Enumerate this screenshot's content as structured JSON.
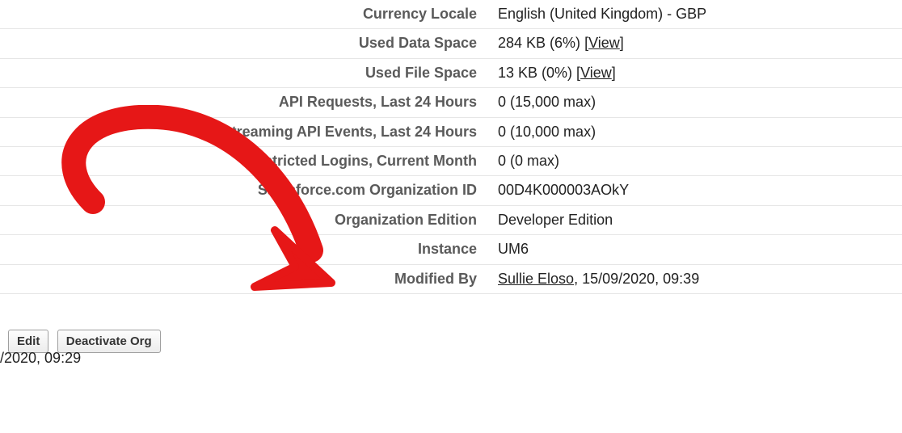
{
  "rows": {
    "currency_locale": {
      "label": "Currency Locale",
      "value": "English (United Kingdom) - GBP"
    },
    "used_data_space": {
      "label": "Used Data Space",
      "value": "284 KB (6%) ",
      "link_text": "View"
    },
    "used_file_space": {
      "label": "Used File Space",
      "value": "13 KB (0%) ",
      "link_text": "View"
    },
    "api_requests": {
      "label": "API Requests, Last 24 Hours",
      "value": "0 (15,000 max)"
    },
    "streaming_api": {
      "label": "Streaming API Events, Last 24 Hours",
      "value": "0 (10,000 max)"
    },
    "restricted_logins": {
      "label": "estricted Logins, Current Month",
      "value": "0 (0 max)"
    },
    "org_id": {
      "label": "Salesforce.com Organization ID",
      "value": "00D4K000003AOkY"
    },
    "org_edition": {
      "label": "Organization Edition",
      "value": "Developer Edition"
    },
    "instance": {
      "label": "Instance",
      "value": "UM6"
    },
    "modified_by": {
      "label": "Modified By",
      "user": "Sullie Eloso",
      "suffix": ", 15/09/2020, 09:39"
    }
  },
  "created_fragment": "/2020, 09:29",
  "buttons": {
    "edit": "Edit",
    "deactivate": "Deactivate Org"
  },
  "brackets": {
    "open": "[",
    "close": "]"
  }
}
